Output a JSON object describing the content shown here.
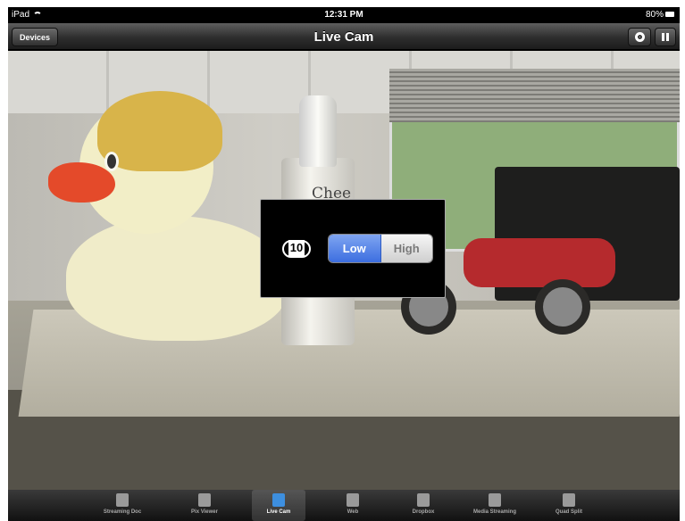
{
  "status_bar": {
    "carrier": "iPad",
    "time": "12:31 PM",
    "battery": "80%"
  },
  "nav": {
    "left_button": "Devices",
    "title": "Live Cam",
    "right_icons": [
      "gear-icon",
      "pause-icon"
    ]
  },
  "camera": {
    "label_on_can": "Chee"
  },
  "quality_popup": {
    "icon_number": "10",
    "options": [
      "Low",
      "High"
    ],
    "selected": "Low"
  },
  "tab_bar": {
    "tabs": [
      {
        "label": "Streaming Doc",
        "icon": "document-icon",
        "active": false
      },
      {
        "label": "Pix Viewer",
        "icon": "picture-icon",
        "active": false
      },
      {
        "label": "Live Cam",
        "icon": "camera-icon",
        "active": true
      },
      {
        "label": "Web",
        "icon": "globe-icon",
        "active": false
      },
      {
        "label": "Dropbox",
        "icon": "dropbox-icon",
        "active": false
      },
      {
        "label": "Media Streaming",
        "icon": "media-icon",
        "active": false
      },
      {
        "label": "Quad Split",
        "icon": "pen-icon",
        "active": false
      }
    ]
  },
  "colors": {
    "segment_selected": "#3c6ee0",
    "nav_bar": "#2e2e2e"
  }
}
